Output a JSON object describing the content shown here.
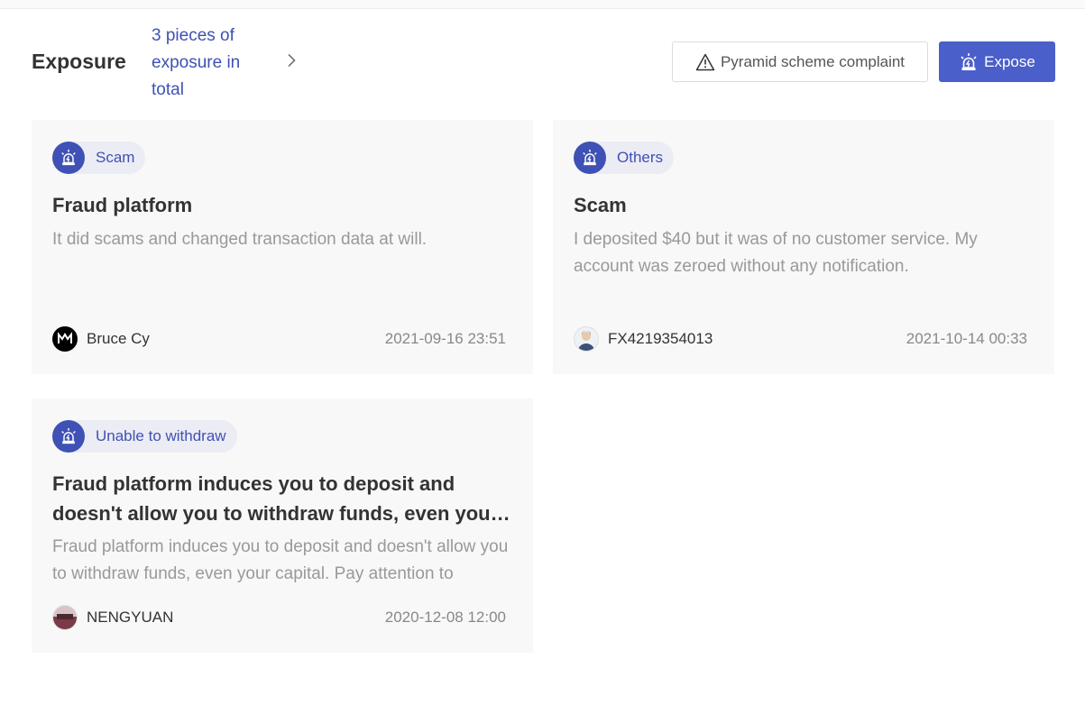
{
  "header": {
    "title": "Exposure",
    "count_text": "3 pieces of exposure in total",
    "complaint_label": "Pyramid scheme complaint",
    "expose_label": "Expose"
  },
  "colors": {
    "accent": "#3f51b5",
    "button_bg": "#4a5fc9",
    "card_bg": "#f8f8f9"
  },
  "cards": [
    {
      "tag": "Scam",
      "title": "Fraud platform",
      "description": "It did scams and changed transaction data at will.",
      "author": "Bruce Cy",
      "date": "2021-09-16 23:51",
      "avatar_icon": "m-logo-avatar"
    },
    {
      "tag": "Others",
      "title": "Scam",
      "description": "I deposited $40 but it was of no customer service. My account was zeroed without any notification.",
      "author": "FX4219354013",
      "date": "2021-10-14 00:33",
      "avatar_icon": "person-avatar"
    },
    {
      "tag": "Unable to withdraw",
      "title": "Fraud platform induces you to deposit and doesn't allow you to withdraw funds, even your capital. Pay attention to",
      "description": "Fraud platform induces you to deposit and doesn't allow you to withdraw funds, even your capital. Pay attention to",
      "author": "NENGYUAN",
      "date": "2020-12-08 12:00",
      "avatar_icon": "photo-avatar"
    }
  ]
}
